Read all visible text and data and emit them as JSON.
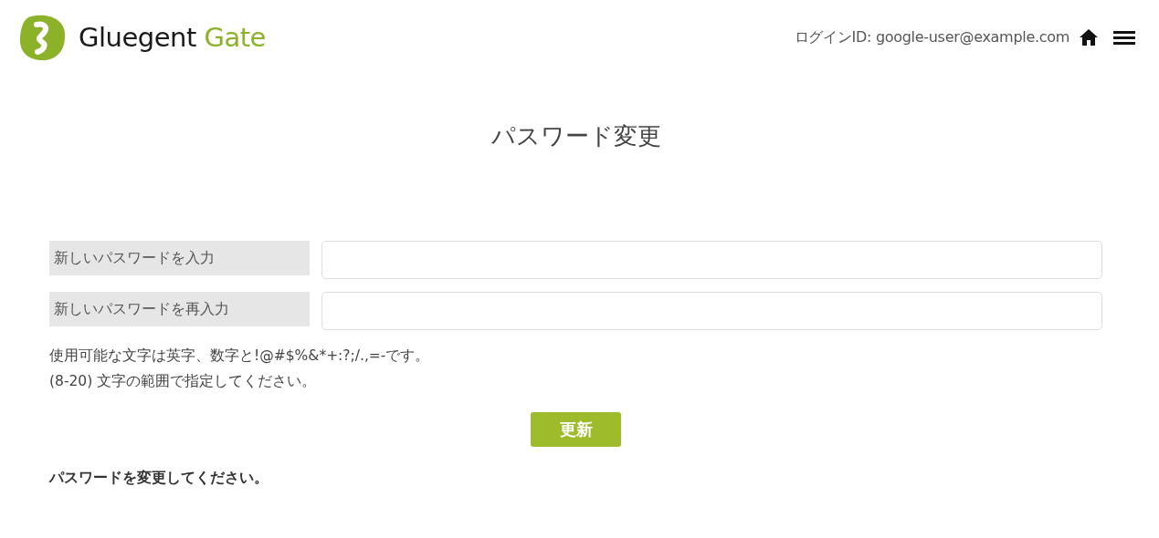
{
  "header": {
    "brand_name": "Gluegent",
    "brand_product": "Gate",
    "login_label": "ログインID: google-user@example.com"
  },
  "title": "パスワード変更",
  "fields": [
    {
      "label": "新しいパスワードを入力"
    },
    {
      "label": "新しいパスワードを再入力"
    }
  ],
  "notes": [
    "使用可能な文字は英字、数字と!@#$%&*+:?;/.,=-です。",
    "(8-20) 文字の範囲で指定してください。"
  ],
  "submit_button": "更新",
  "message": "パスワードを変更してください。"
}
